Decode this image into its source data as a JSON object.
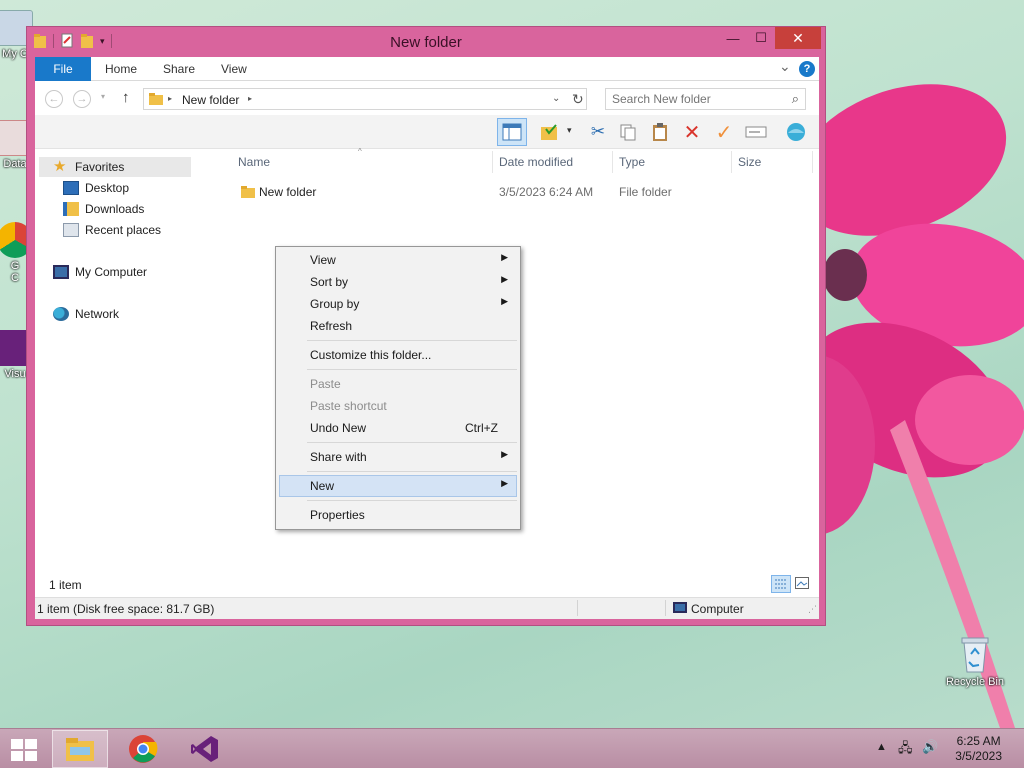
{
  "window": {
    "title": "New folder",
    "minimize_glyph": "—",
    "maximize_glyph": "☐",
    "close_glyph": "✕"
  },
  "ribbon": {
    "tabs": [
      "File",
      "Home",
      "Share",
      "View"
    ],
    "help_glyph": "?",
    "expand_glyph": "⌄"
  },
  "address": {
    "path": "New folder",
    "search_placeholder": "Search New folder"
  },
  "nav_pane": {
    "favorites": "Favorites",
    "desktop": "Desktop",
    "downloads": "Downloads",
    "recent_places": "Recent places",
    "my_computer": "My Computer",
    "network": "Network"
  },
  "columns": [
    "Name",
    "Date modified",
    "Type",
    "Size"
  ],
  "files": [
    {
      "name": "New folder",
      "date": "3/5/2023 6:24 AM",
      "type": "File folder",
      "size": ""
    }
  ],
  "status": {
    "item_count": "1 item",
    "detail": "1 item (Disk free space: 81.7 GB)",
    "location": "Computer"
  },
  "context_menu": {
    "view": "View",
    "sort_by": "Sort by",
    "group_by": "Group by",
    "refresh": "Refresh",
    "customize": "Customize this folder...",
    "paste": "Paste",
    "paste_shortcut": "Paste shortcut",
    "undo_new": "Undo New",
    "undo_shortcut": "Ctrl+Z",
    "share_with": "Share with",
    "new": "New",
    "properties": "Properties"
  },
  "desktop_icons": {
    "my_computer": "My C",
    "data": "Data",
    "chrome": "G",
    "chrome2": "C",
    "visual": "Visu",
    "recycle_bin": "Recycle Bin"
  },
  "taskbar": {
    "time": "6:25 AM",
    "date": "3/5/2023"
  },
  "colors": {
    "window_frame": "#d9649d",
    "ribbon_file": "#1979ca",
    "menu_highlight": "#d4e3f5"
  }
}
